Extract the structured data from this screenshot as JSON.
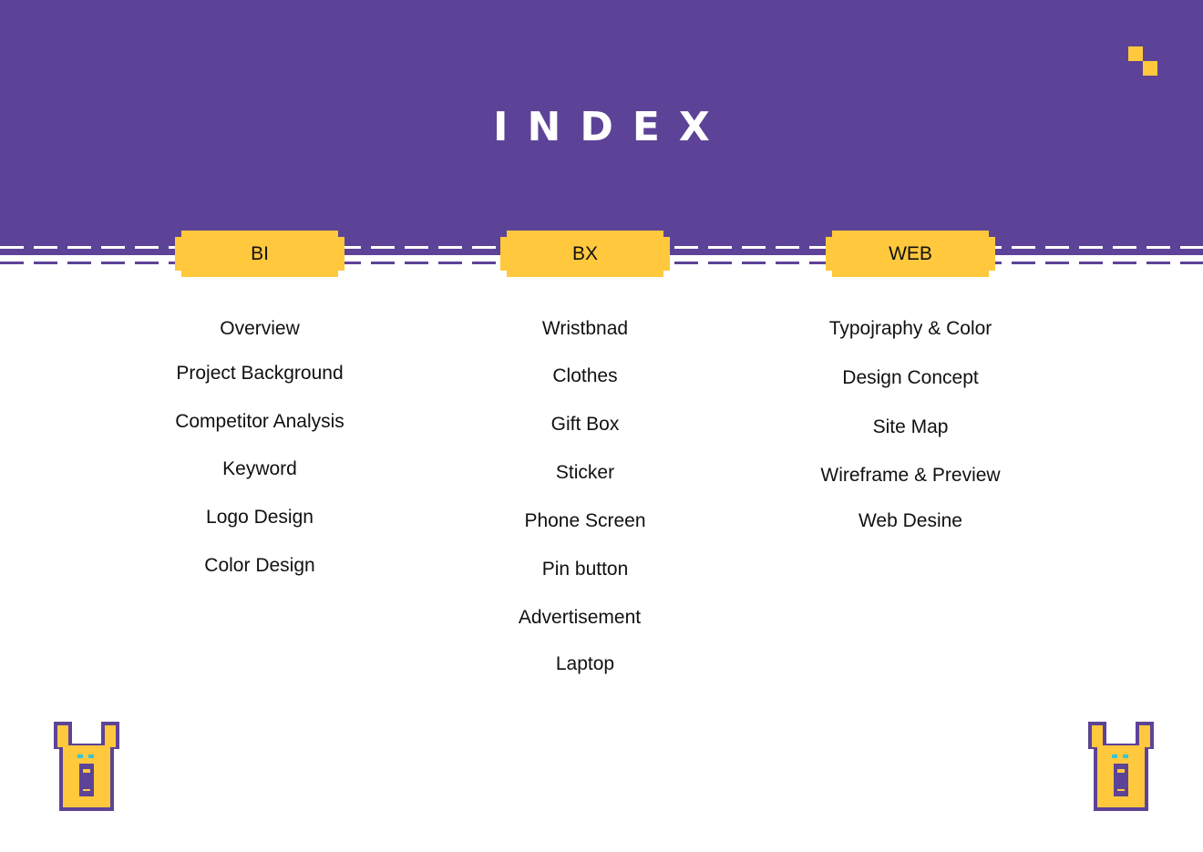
{
  "title": "INDEX",
  "colors": {
    "band": "#5d4397",
    "accent": "#ffc83d",
    "text": "#111111"
  },
  "tabs": [
    {
      "label": "BI",
      "items": [
        "Overview",
        "Project Background",
        "Competitor Analysis",
        "Keyword",
        "Logo Design",
        "Color Design"
      ]
    },
    {
      "label": "BX",
      "items": [
        "Wristbnad",
        "Clothes",
        "Gift Box",
        "Sticker",
        "Phone Screen",
        "Pin button",
        "Advertisement",
        "Laptop"
      ]
    },
    {
      "label": "WEB",
      "items": [
        "Typojraphy & Color",
        "Design Concept",
        "Site Map",
        "Wireframe & Preview",
        "Web Desine"
      ]
    }
  ],
  "icons": {
    "corner": "pixel-squares-icon",
    "mascot": "pixel-rabbit-mascot-icon"
  }
}
